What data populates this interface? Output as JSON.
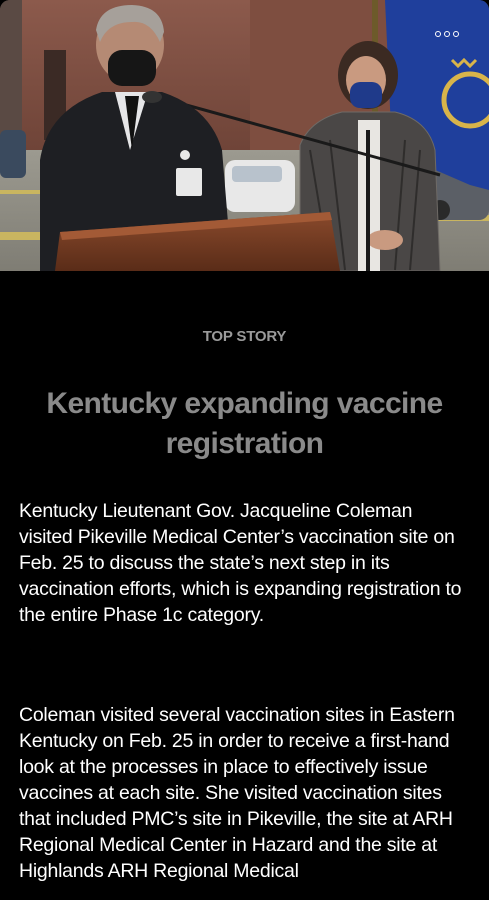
{
  "hero": {
    "more_icon": "more-horizontal-icon"
  },
  "article": {
    "kicker": "TOP STORY",
    "headline": "Kentucky expanding vaccine registration",
    "paragraphs": [
      "Kentucky Lieutenant Gov. Jacqueline Coleman visited Pikeville Medical Center’s vaccination site on Feb. 25 to discuss the state’s next step in its vaccination efforts, which is expanding registration to the entire Phase 1c category.",
      "Coleman visited several vaccination sites in Eastern Kentucky on Feb. 25 in order to receive a first-hand look at the processes in place to effectively issue vaccines at each site. She visited vaccination sites that included PMC’s site in Pikeville, the site at ARH Regional Medical Center in Hazard and the site at Highlands ARH Regional Medical"
    ]
  },
  "colors": {
    "background": "#000000",
    "kicker": "#9a9a9a",
    "headline": "#8a8a8a",
    "body": "#ffffff",
    "flag": "#1f3f9c"
  }
}
